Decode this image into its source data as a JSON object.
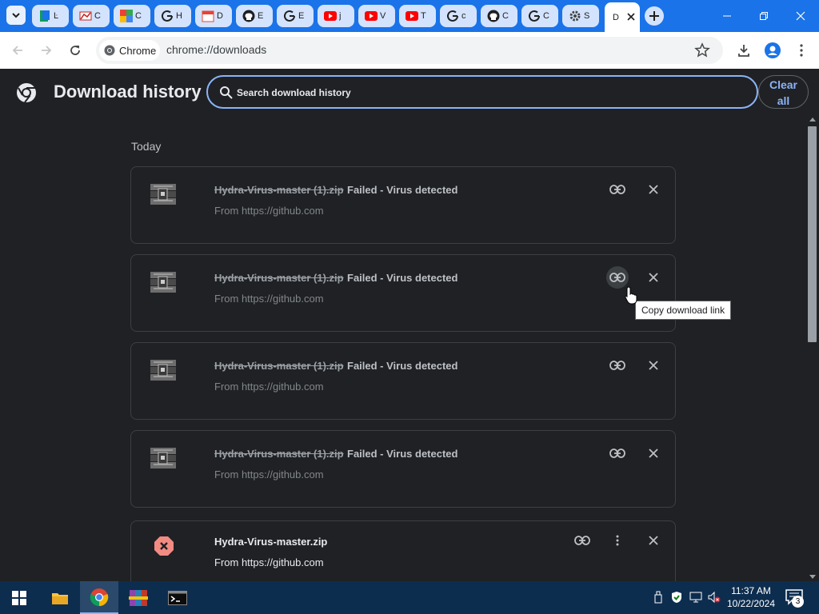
{
  "tabs": [
    {
      "title": "Ŀ",
      "icon": "green-bookmark-icon"
    },
    {
      "title": "C",
      "icon": "chart-app-icon"
    },
    {
      "title": "C",
      "icon": "colorful-grid-icon"
    },
    {
      "title": "H",
      "icon": "google-icon"
    },
    {
      "title": "D",
      "icon": "red-calendar-icon"
    },
    {
      "title": "E",
      "icon": "github-icon"
    },
    {
      "title": "E",
      "icon": "google-icon"
    },
    {
      "title": "j",
      "icon": "youtube-icon"
    },
    {
      "title": "V",
      "icon": "youtube-icon"
    },
    {
      "title": "T",
      "icon": "youtube-icon"
    },
    {
      "title": "c",
      "icon": "google-icon"
    },
    {
      "title": "C",
      "icon": "github-icon"
    },
    {
      "title": "C",
      "icon": "google-icon"
    },
    {
      "title": "S",
      "icon": "settings-gear-icon"
    }
  ],
  "active_tab": {
    "title": "D",
    "icon": "downloads-icon"
  },
  "omnibox": {
    "chip_label": "Chrome",
    "url": "chrome://downloads"
  },
  "downloads": {
    "title": "Download history",
    "search_placeholder": "Search download history",
    "clear_all": "Clear\nall",
    "section_label": "Today",
    "items": [
      {
        "filename": "Hydra-Virus-master (1).zip",
        "status": "Failed - Virus detected",
        "source": "From https://github.com",
        "icon": "winrar-archive-icon",
        "copy_hover": false
      },
      {
        "filename": "Hydra-Virus-master (1).zip",
        "status": "Failed - Virus detected",
        "source": "From https://github.com",
        "icon": "winrar-archive-icon",
        "copy_hover": true
      },
      {
        "filename": "Hydra-Virus-master (1).zip",
        "status": "Failed - Virus detected",
        "source": "From https://github.com",
        "icon": "winrar-archive-icon",
        "copy_hover": false
      },
      {
        "filename": "Hydra-Virus-master (1).zip",
        "status": "Failed - Virus detected",
        "source": "From https://github.com",
        "icon": "winrar-archive-icon",
        "copy_hover": false
      }
    ],
    "last_item": {
      "filename": "Hydra-Virus-master.zip",
      "source": "From https://github.com",
      "icon": "error-x-icon"
    },
    "tooltip": "Copy download link"
  },
  "taskbar": {
    "apps": [
      "file-explorer-icon",
      "chrome-icon",
      "winrar-icon",
      "terminal-icon"
    ],
    "time": "11:37 AM",
    "date": "10/22/2024",
    "notification_count": "3"
  },
  "colors": {
    "tabstrip": "#1a73e8",
    "accent": "#8ab4f8",
    "page_bg": "#202124",
    "error": "#f28b82",
    "taskbar": "#0d2d4f"
  }
}
